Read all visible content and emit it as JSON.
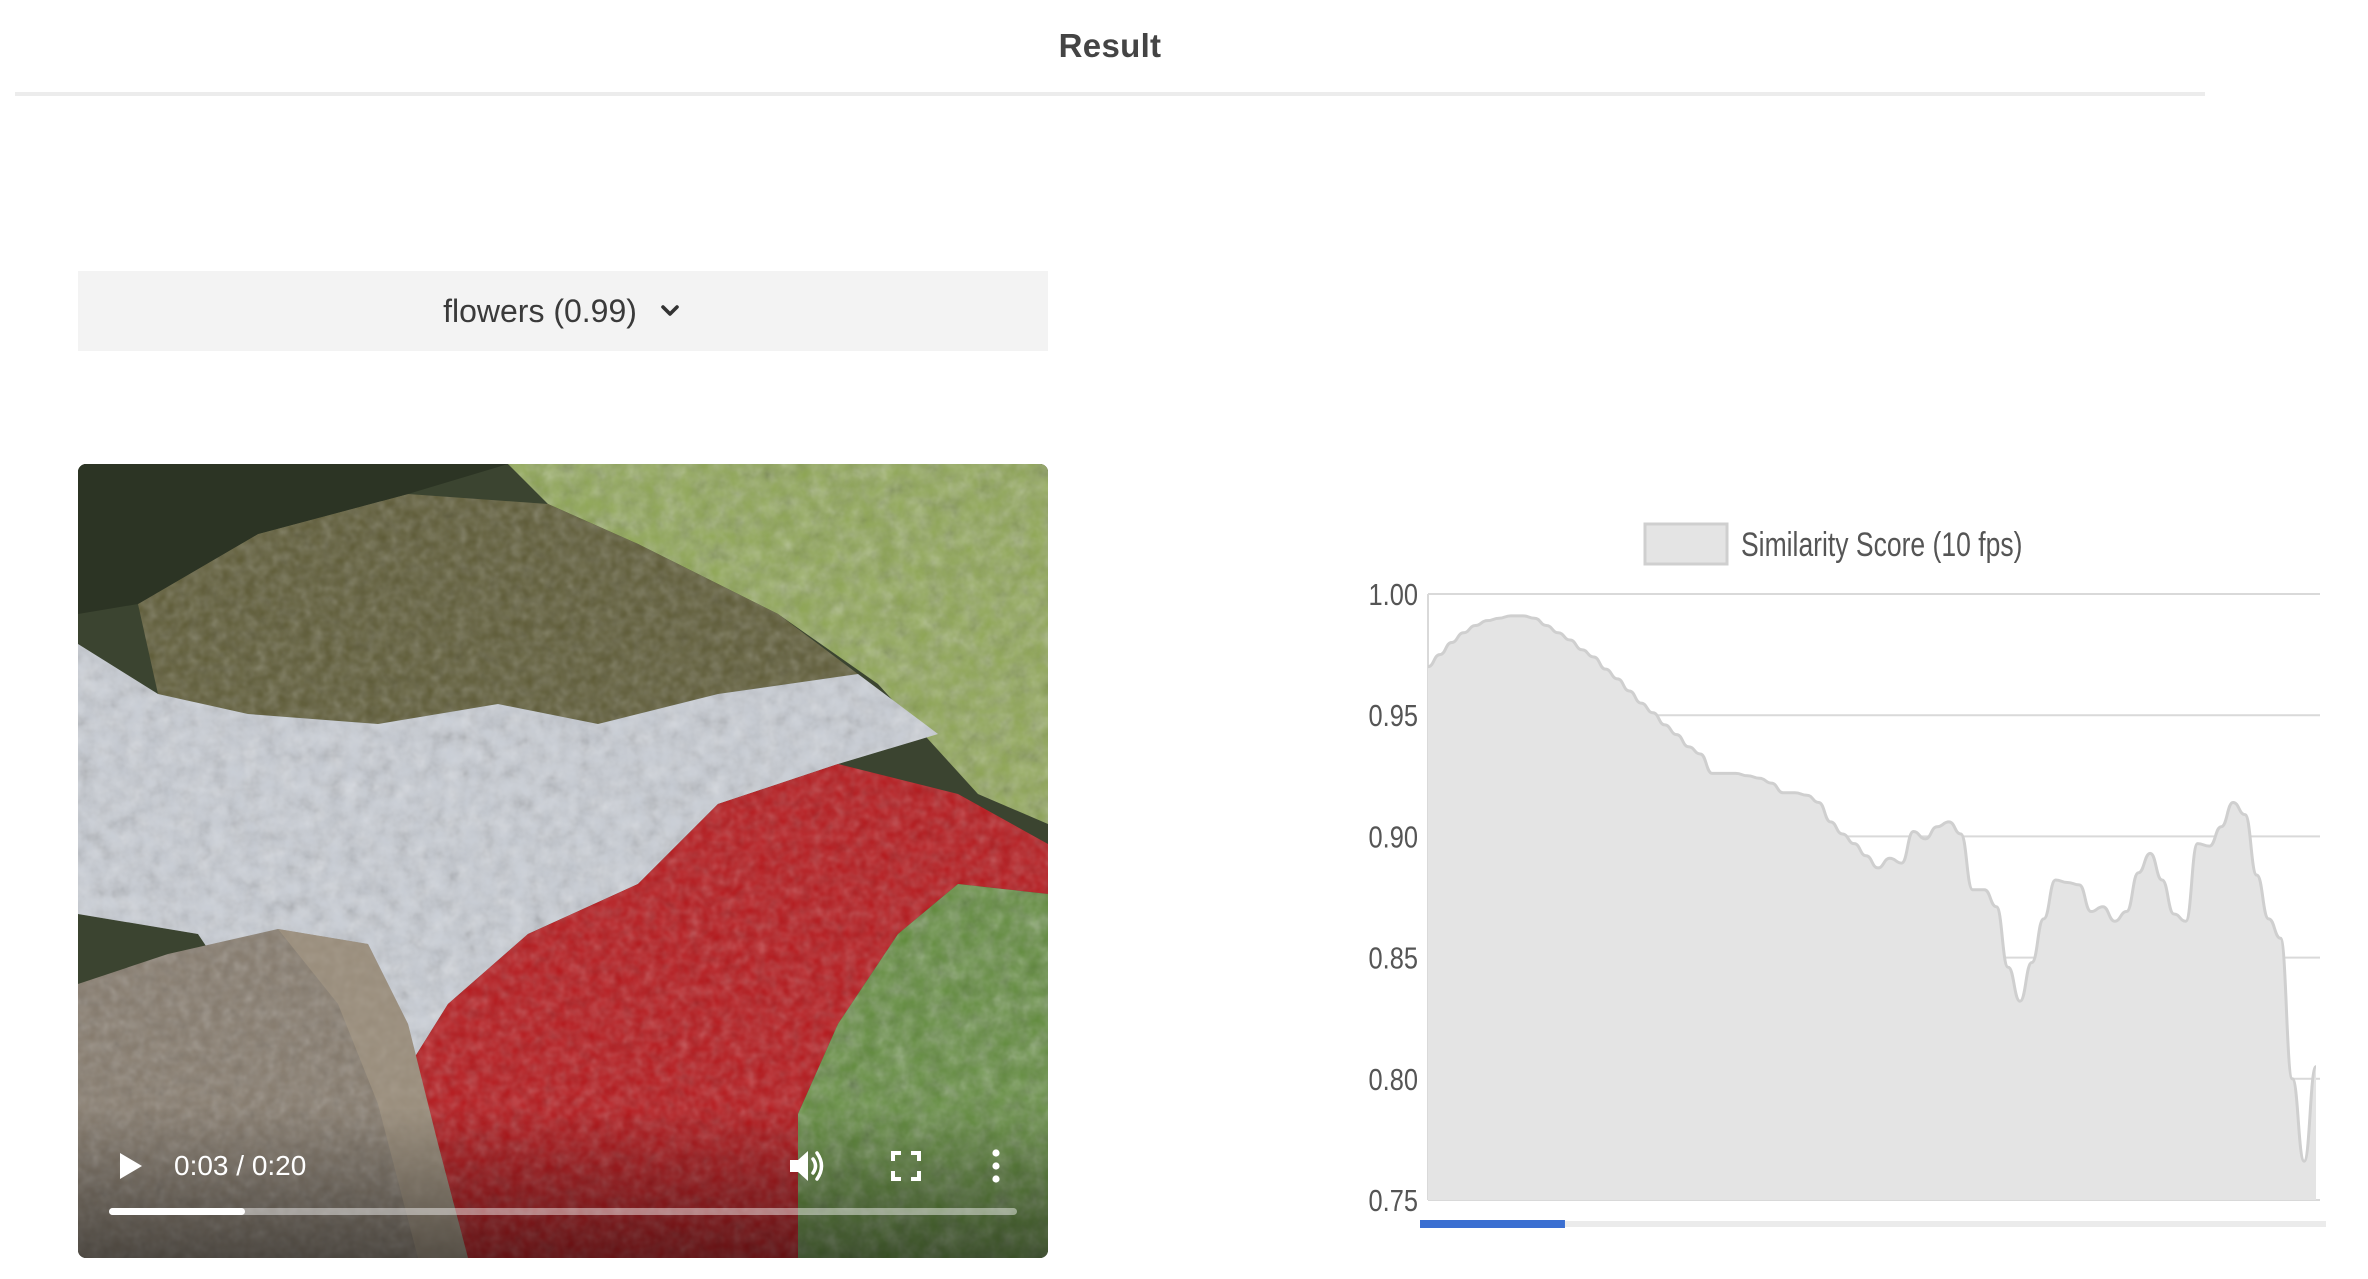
{
  "header": {
    "title": "Result"
  },
  "dropdown": {
    "selected": "flowers (0.99)"
  },
  "video": {
    "time_display": "0:03 / 0:20",
    "progress": 0.15
  },
  "icons": {
    "play": "play-icon",
    "volume": "volume-icon",
    "fullscreen": "fullscreen-icon",
    "more": "more-vertical-icon",
    "chevron": "chevron-down-icon"
  },
  "colors": {
    "area_fill": "#e4e4e4",
    "area_stroke": "#cfcfcf",
    "scrubber": "#3b6fd1",
    "gridline": "#d9d9d9"
  },
  "chart_data": {
    "type": "area",
    "title": "",
    "xlabel": "",
    "ylabel": "",
    "ylim": [
      0.75,
      1.0
    ],
    "yticks": [
      "1.00",
      "0.95",
      "0.90",
      "0.85",
      "0.80",
      "0.75"
    ],
    "grid": true,
    "legend": "top",
    "playback_position": 0.16,
    "series": [
      {
        "name": "Similarity Score (10 fps)",
        "values": [
          0.97,
          0.975,
          0.98,
          0.984,
          0.987,
          0.989,
          0.99,
          0.991,
          0.991,
          0.99,
          0.987,
          0.984,
          0.981,
          0.977,
          0.974,
          0.969,
          0.965,
          0.96,
          0.955,
          0.951,
          0.946,
          0.942,
          0.937,
          0.934,
          0.926,
          0.926,
          0.926,
          0.925,
          0.924,
          0.922,
          0.918,
          0.918,
          0.917,
          0.914,
          0.906,
          0.901,
          0.897,
          0.892,
          0.887,
          0.891,
          0.889,
          0.902,
          0.899,
          0.904,
          0.906,
          0.901,
          0.878,
          0.878,
          0.871,
          0.846,
          0.832,
          0.848,
          0.866,
          0.882,
          0.881,
          0.88,
          0.869,
          0.871,
          0.865,
          0.869,
          0.885,
          0.893,
          0.882,
          0.868,
          0.865,
          0.897,
          0.896,
          0.904,
          0.914,
          0.909,
          0.884,
          0.866,
          0.858,
          0.8,
          0.766,
          0.805
        ]
      }
    ]
  }
}
